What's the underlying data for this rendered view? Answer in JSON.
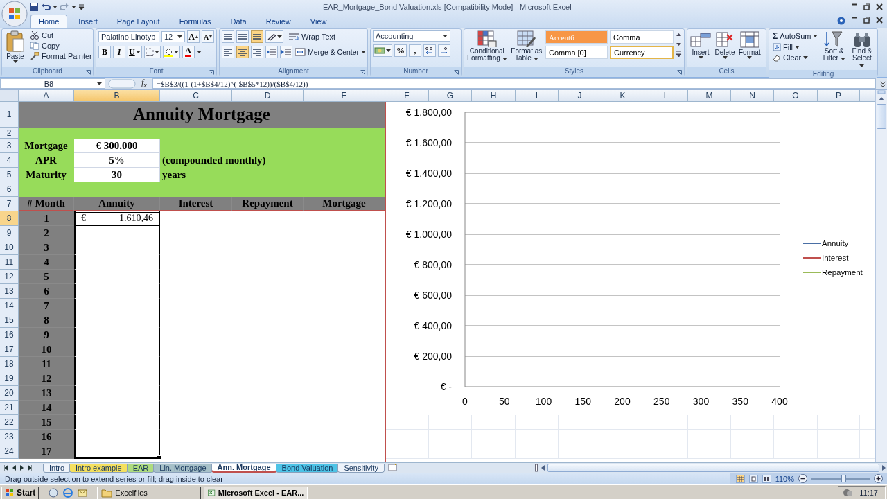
{
  "title_bar": {
    "title": "EAR_Mortgage_Bond Valuation.xls  [Compatibility Mode] - Microsoft Excel"
  },
  "ribbon_tabs": [
    {
      "label": "Home",
      "selected": true
    },
    {
      "label": "Insert",
      "selected": false
    },
    {
      "label": "Page Layout",
      "selected": false
    },
    {
      "label": "Formulas",
      "selected": false
    },
    {
      "label": "Data",
      "selected": false
    },
    {
      "label": "Review",
      "selected": false
    },
    {
      "label": "View",
      "selected": false
    }
  ],
  "clipboard": {
    "paste": "Paste",
    "cut": "Cut",
    "copy": "Copy",
    "format_painter": "Format Painter",
    "label": "Clipboard"
  },
  "font": {
    "family": "Palatino Linotyp",
    "size": "12",
    "grow": "A",
    "shrink": "A",
    "bold": "B",
    "italic": "I",
    "underline": "U",
    "color_letter": "A",
    "label": "Font"
  },
  "alignment": {
    "valign_buttons": [
      {
        "selected": false
      },
      {
        "selected": false
      },
      {
        "selected": true
      }
    ],
    "halign_buttons": [
      {
        "selected": false
      },
      {
        "selected": true
      },
      {
        "selected": false
      }
    ],
    "wrap": "Wrap Text",
    "merge": "Merge & Center",
    "label": "Alignment"
  },
  "number": {
    "format": "Accounting",
    "percent": "%",
    "comma": ",",
    "label": "Number"
  },
  "styles": {
    "conditional": "Conditional Formatting",
    "format_table": "Format as Table",
    "options": [
      {
        "text": "Accent6",
        "kind": "accent",
        "selected": false
      },
      {
        "text": "Comma",
        "kind": "plain",
        "selected": false
      },
      {
        "text": "Comma [0]",
        "kind": "plain",
        "selected": false
      },
      {
        "text": "Currency",
        "kind": "plain",
        "selected": true
      }
    ],
    "label": "Styles"
  },
  "cells": {
    "buttons": [
      "Insert",
      "Delete",
      "Format"
    ],
    "label": "Cells"
  },
  "editing": {
    "sigma": "Σ",
    "autosum": "AutoSum",
    "fill": "Fill",
    "clear": "Clear",
    "sort": "Sort & Filter",
    "find": "Find & Select",
    "label": "Editing"
  },
  "formula_bar": {
    "name_box": "B8",
    "fx": "f$_{x}$",
    "formula": "=$B$3/((1-(1+$B$4/12)^(-$B$5*12))/($B$4/12))"
  },
  "columns": [
    {
      "label": "A",
      "selected": false
    },
    {
      "label": "B",
      "selected": true
    },
    {
      "label": "C",
      "selected": false
    },
    {
      "label": "D",
      "selected": false
    },
    {
      "label": "E",
      "selected": false
    },
    {
      "label": "F",
      "selected": false
    },
    {
      "label": "G",
      "selected": false
    },
    {
      "label": "H",
      "selected": false
    },
    {
      "label": "I",
      "selected": false
    },
    {
      "label": "J",
      "selected": false
    },
    {
      "label": "K",
      "selected": false
    },
    {
      "label": "L",
      "selected": false
    },
    {
      "label": "M",
      "selected": false
    },
    {
      "label": "N",
      "selected": false
    },
    {
      "label": "O",
      "selected": false
    },
    {
      "label": "P",
      "selected": false
    }
  ],
  "rows": [
    {
      "number": "1",
      "selected": false,
      "cells": [
        {
          "kind": "title",
          "text": "Annuity Mortgage"
        }
      ]
    },
    {
      "number": "2",
      "selected": false,
      "cells": [
        {
          "kind": "fill"
        }
      ]
    },
    {
      "number": "3",
      "selected": false,
      "cells": [
        {
          "kind": "label",
          "text": "Mortgage"
        },
        {
          "kind": "input",
          "text": "€ 300.000"
        },
        {
          "kind": "fill"
        }
      ]
    },
    {
      "number": "4",
      "selected": false,
      "cells": [
        {
          "kind": "label",
          "text": "APR"
        },
        {
          "kind": "input",
          "text": "5%"
        },
        {
          "kind": "note",
          "text": "(compounded monthly)"
        }
      ]
    },
    {
      "number": "5",
      "selected": false,
      "cells": [
        {
          "kind": "label",
          "text": "Maturity"
        },
        {
          "kind": "input",
          "text": "30"
        },
        {
          "kind": "note",
          "text": "years"
        }
      ]
    },
    {
      "number": "6",
      "selected": false,
      "cells": [
        {
          "kind": "fill"
        }
      ]
    },
    {
      "number": "7",
      "selected": false,
      "cells": [
        {
          "kind": "heading",
          "text": "# Month"
        },
        {
          "kind": "heading",
          "text": "Annuity"
        },
        {
          "kind": "heading",
          "text": "Interest"
        },
        {
          "kind": "heading",
          "text": "Repayment"
        },
        {
          "kind": "heading",
          "text": "Mortgage"
        }
      ]
    },
    {
      "number": "8",
      "selected": true,
      "cells": [
        {
          "kind": "month",
          "text": "1"
        },
        {
          "kind": "amount",
          "currency": "€",
          "text": "1.610,46",
          "selected": true
        },
        {
          "kind": "blank"
        }
      ]
    },
    {
      "number": "9",
      "selected": false,
      "cells": [
        {
          "kind": "month",
          "text": "2"
        },
        {
          "kind": "range"
        },
        {
          "kind": "blank"
        }
      ]
    },
    {
      "number": "10",
      "selected": false,
      "cells": [
        {
          "kind": "month",
          "text": "3"
        },
        {
          "kind": "range"
        },
        {
          "kind": "blank"
        }
      ]
    },
    {
      "number": "11",
      "selected": false,
      "cells": [
        {
          "kind": "month",
          "text": "4"
        },
        {
          "kind": "range"
        },
        {
          "kind": "blank"
        }
      ]
    },
    {
      "number": "12",
      "selected": false,
      "cells": [
        {
          "kind": "month",
          "text": "5"
        },
        {
          "kind": "range"
        },
        {
          "kind": "blank"
        }
      ]
    },
    {
      "number": "13",
      "selected": false,
      "cells": [
        {
          "kind": "month",
          "text": "6"
        },
        {
          "kind": "range"
        },
        {
          "kind": "blank"
        }
      ]
    },
    {
      "number": "14",
      "selected": false,
      "cells": [
        {
          "kind": "month",
          "text": "7"
        },
        {
          "kind": "range"
        },
        {
          "kind": "blank"
        }
      ]
    },
    {
      "number": "15",
      "selected": false,
      "cells": [
        {
          "kind": "month",
          "text": "8"
        },
        {
          "kind": "range"
        },
        {
          "kind": "blank"
        }
      ]
    },
    {
      "number": "16",
      "selected": false,
      "cells": [
        {
          "kind": "month",
          "text": "9"
        },
        {
          "kind": "range"
        },
        {
          "kind": "blank"
        }
      ]
    },
    {
      "number": "17",
      "selected": false,
      "cells": [
        {
          "kind": "month",
          "text": "10"
        },
        {
          "kind": "range"
        },
        {
          "kind": "blank"
        }
      ]
    },
    {
      "number": "18",
      "selected": false,
      "cells": [
        {
          "kind": "month",
          "text": "11"
        },
        {
          "kind": "range"
        },
        {
          "kind": "blank"
        }
      ]
    },
    {
      "number": "19",
      "selected": false,
      "cells": [
        {
          "kind": "month",
          "text": "12"
        },
        {
          "kind": "range"
        },
        {
          "kind": "blank"
        }
      ]
    },
    {
      "number": "20",
      "selected": false,
      "cells": [
        {
          "kind": "month",
          "text": "13"
        },
        {
          "kind": "range"
        },
        {
          "kind": "blank"
        }
      ]
    },
    {
      "number": "21",
      "selected": false,
      "cells": [
        {
          "kind": "month",
          "text": "14"
        },
        {
          "kind": "range"
        },
        {
          "kind": "blank"
        }
      ]
    },
    {
      "number": "22",
      "selected": false,
      "cells": [
        {
          "kind": "month",
          "text": "15"
        },
        {
          "kind": "range"
        },
        {
          "kind": "blank"
        }
      ]
    },
    {
      "number": "23",
      "selected": false,
      "cells": [
        {
          "kind": "month",
          "text": "16"
        },
        {
          "kind": "range"
        },
        {
          "kind": "blank"
        }
      ]
    },
    {
      "number": "24",
      "selected": false,
      "cells": [
        {
          "kind": "month",
          "text": "17"
        },
        {
          "kind": "range"
        },
        {
          "kind": "blank"
        }
      ]
    }
  ],
  "chart": {
    "chart_data": {
      "type": "line",
      "grid": true,
      "ylim": [
        0,
        1800
      ],
      "categories": [
        "0",
        "50",
        "100",
        "150",
        "200",
        "250",
        "300",
        "350",
        "400"
      ],
      "yticks": [
        {
          "value": 0,
          "label": "€ -"
        },
        {
          "value": 200,
          "label": "€ 200,00"
        },
        {
          "value": 400,
          "label": "€ 400,00"
        },
        {
          "value": 600,
          "label": "€ 600,00"
        },
        {
          "value": 800,
          "label": "€ 800,00"
        },
        {
          "value": 1000,
          "label": "€ 1.000,00"
        },
        {
          "value": 1200,
          "label": "€ 1.200,00"
        },
        {
          "value": 1400,
          "label": "€ 1.400,00"
        },
        {
          "value": 1600,
          "label": "€ 1.600,00"
        },
        {
          "value": 1800,
          "label": "€ 1.800,00"
        }
      ],
      "series": [
        {
          "name": "Annuity",
          "color": "#4a6fa5",
          "values": [
            null,
            null,
            null,
            null,
            null,
            null,
            null,
            null,
            null
          ]
        },
        {
          "name": "Interest",
          "color": "#c0504d",
          "values": [
            null,
            null,
            null,
            null,
            null,
            null,
            null,
            null,
            null
          ]
        },
        {
          "name": "Repayment",
          "color": "#9bbb59",
          "values": [
            null,
            null,
            null,
            null,
            null,
            null,
            null,
            null,
            null
          ]
        }
      ]
    }
  },
  "sheet_tabs": [
    {
      "label": "Intro",
      "selected": false
    },
    {
      "label": "Intro example",
      "selected": false,
      "color": "#f5e05e"
    },
    {
      "label": "EAR",
      "selected": false,
      "color": "#aedc7e"
    },
    {
      "label": "Lin. Mortgage",
      "selected": false,
      "color": "#a6c0c8"
    },
    {
      "label": "Ann. Mortgage",
      "selected": true,
      "color": "#c0504d"
    },
    {
      "label": "Bond Valuation",
      "selected": false,
      "color": "#4dc3e6"
    },
    {
      "label": "Sensitivity",
      "selected": false
    }
  ],
  "status_bar": {
    "message": "Drag outside selection to extend series or fill; drag inside to clear",
    "zoom": "110%",
    "zoom_slider": {
      "level": 0.55
    }
  },
  "taskbar": {
    "start": "Start",
    "windows": [
      {
        "label": "Excelfiles",
        "selected": false
      },
      {
        "label": "Microsoft Excel - EAR...",
        "selected": true
      }
    ],
    "clock": "11:17"
  }
}
